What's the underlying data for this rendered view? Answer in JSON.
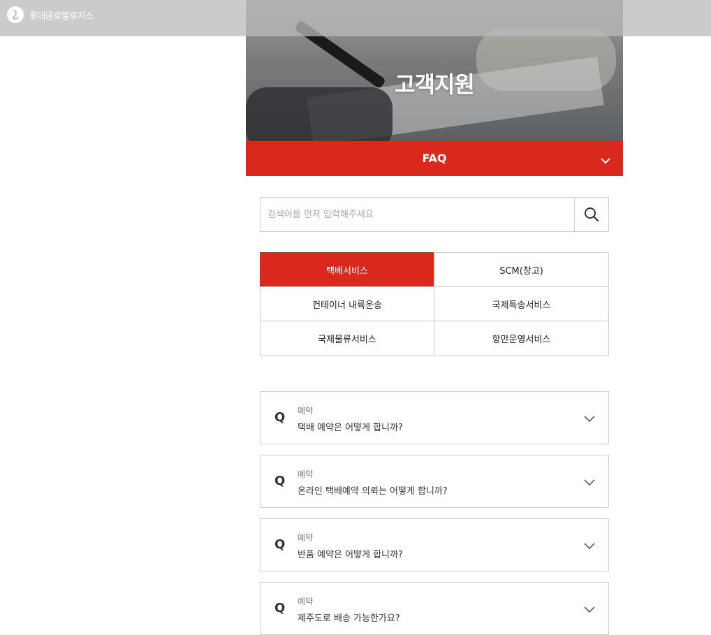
{
  "header": {
    "logo_text": "롯데글로벌로지스"
  },
  "hero": {
    "title": "고객지원"
  },
  "section_bar": {
    "label": "FAQ"
  },
  "search": {
    "placeholder": "검색어를 먼저 입력해주세요",
    "value": ""
  },
  "categories": [
    {
      "label": "택배서비스",
      "active": true
    },
    {
      "label": "SCM(창고)",
      "active": false
    },
    {
      "label": "컨테이너 내륙운송",
      "active": false
    },
    {
      "label": "국제특송서비스",
      "active": false
    },
    {
      "label": "국제물류서비스",
      "active": false
    },
    {
      "label": "항만운영서비스",
      "active": false
    }
  ],
  "faq": [
    {
      "q": "Q",
      "category": "예약",
      "question": "택배 예약은 어떻게 합니까?"
    },
    {
      "q": "Q",
      "category": "예약",
      "question": "온라인 택배예약 의뢰는 어떻게 합니까?"
    },
    {
      "q": "Q",
      "category": "예약",
      "question": "반품 예약은 어떻게 합니까?"
    },
    {
      "q": "Q",
      "category": "예약",
      "question": "제주도로 배송 가능한가요?"
    }
  ],
  "colors": {
    "accent": "#da291c",
    "border": "#cfcfcf"
  },
  "icons": {
    "logo": "lotte-logo-icon",
    "dropdown": "chevron-down-icon",
    "search": "search-icon",
    "expand": "chevron-down-icon"
  }
}
